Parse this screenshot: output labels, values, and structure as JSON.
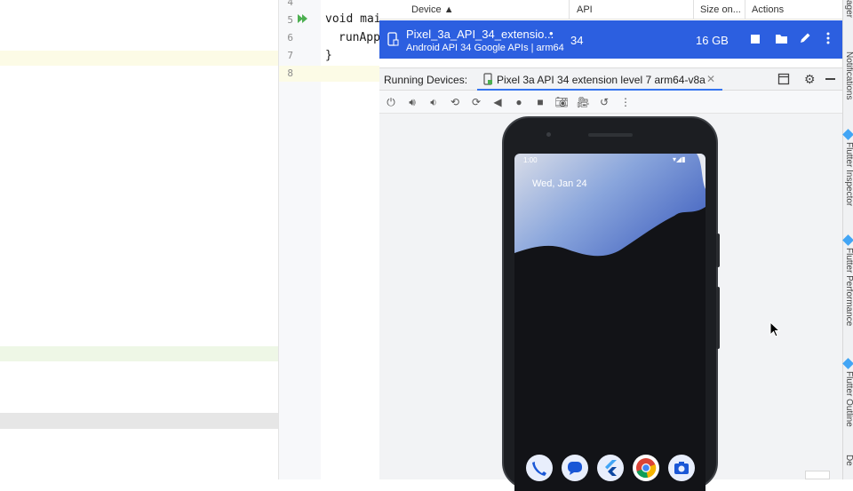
{
  "editor": {
    "line_numbers": [
      "4",
      "5",
      "6",
      "7",
      "8"
    ],
    "code_lines": [
      "void mai",
      "runApp",
      "}",
      ""
    ]
  },
  "device_manager": {
    "columns": [
      "Device",
      "API",
      "Size on...",
      "Actions"
    ],
    "device": {
      "name": "Pixel_3a_API_34_extensio...",
      "subtitle": "Android API 34 Google APIs | arm64",
      "api": "34",
      "size": "16 GB",
      "status_dot": "•"
    }
  },
  "running_devices": {
    "label": "Running Devices:",
    "tab_title": "Pixel 3a API 34 extension level 7 arm64-v8a"
  },
  "emulator_screen": {
    "status_time": "1:00",
    "date_text": "Wed, Jan 24",
    "dock_apps": [
      "phone-icon",
      "messages-icon",
      "flutter-icon",
      "chrome-icon",
      "camera-icon"
    ]
  },
  "right_strip": {
    "labels": [
      "ager",
      "Notifications",
      "Flutter Inspector",
      "Flutter Performance",
      "Flutter Outline",
      "De"
    ]
  },
  "colors": {
    "selected_row": "#2c5fe0",
    "accent": "#3574f0"
  }
}
